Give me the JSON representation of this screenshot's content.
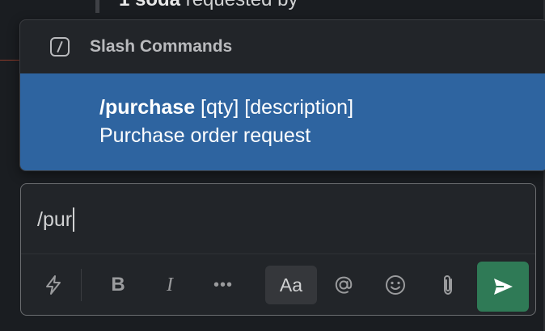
{
  "background": {
    "message_bold": "1 soda",
    "message_rest": " requested by"
  },
  "popup": {
    "title": "Slash Commands",
    "icon": "slash-command-icon",
    "command": {
      "name": "/purchase",
      "args": " [qty] [description]",
      "description": "Purchase order request"
    }
  },
  "composer": {
    "value": "/pur"
  },
  "toolbar": {
    "shortcuts_icon": "lightning-icon",
    "bold_label": "B",
    "italic_label": "I",
    "more_label": "•••",
    "formatting_label": "Aa",
    "mention_icon": "at-icon",
    "emoji_icon": "emoji-icon",
    "attach_icon": "paperclip-icon",
    "send_icon": "send-icon"
  },
  "colors": {
    "selected_bg": "#2e64a0",
    "send_bg": "#2f7a56",
    "app_bg": "#1a1d21"
  }
}
